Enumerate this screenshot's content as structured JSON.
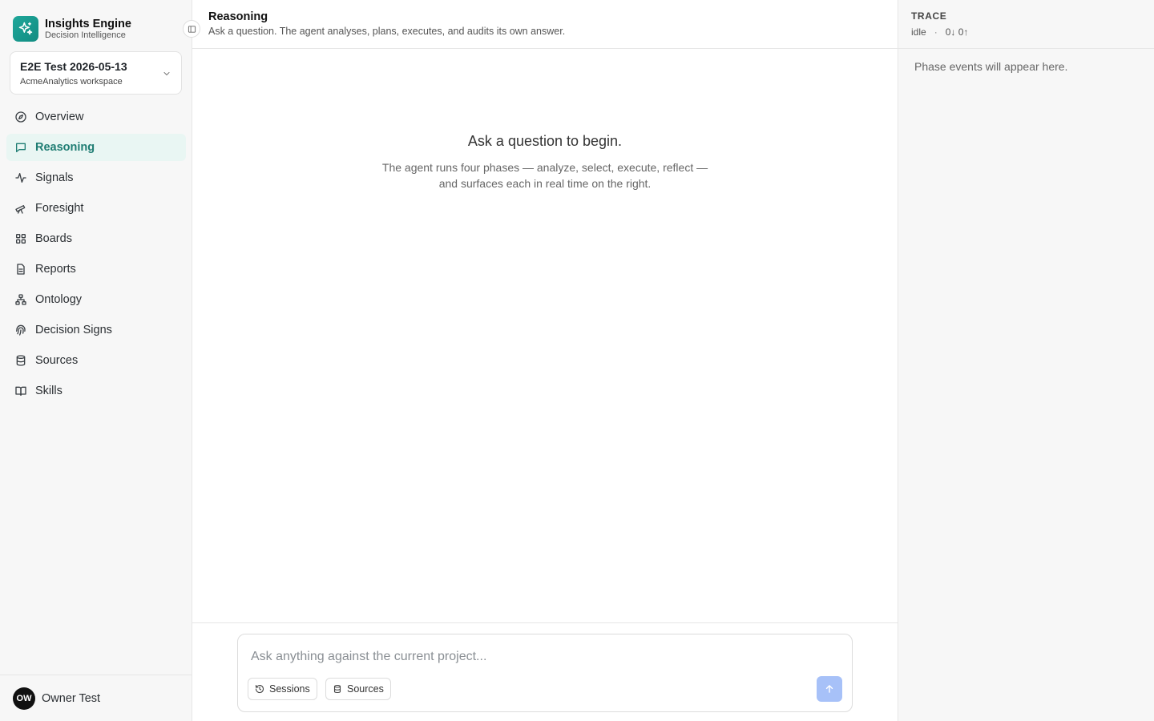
{
  "brand": {
    "name": "Insights Engine",
    "subtitle": "Decision Intelligence",
    "logo_icon": "sparkle-icon",
    "accent": "#1a9e92"
  },
  "workspace": {
    "name": "E2E Test 2026-05-13",
    "subtitle": "AcmeAnalytics workspace"
  },
  "nav": {
    "items": [
      {
        "label": "Overview",
        "icon": "compass-icon",
        "active": false
      },
      {
        "label": "Reasoning",
        "icon": "message-icon",
        "active": true
      },
      {
        "label": "Signals",
        "icon": "activity-icon",
        "active": false
      },
      {
        "label": "Foresight",
        "icon": "telescope-icon",
        "active": false
      },
      {
        "label": "Boards",
        "icon": "grid-icon",
        "active": false
      },
      {
        "label": "Reports",
        "icon": "document-icon",
        "active": false
      },
      {
        "label": "Ontology",
        "icon": "network-icon",
        "active": false
      },
      {
        "label": "Decision Signs",
        "icon": "fingerprint-icon",
        "active": false
      },
      {
        "label": "Sources",
        "icon": "database-icon",
        "active": false
      },
      {
        "label": "Skills",
        "icon": "book-icon",
        "active": false
      }
    ]
  },
  "user": {
    "initials": "OW",
    "name": "Owner Test"
  },
  "header": {
    "title": "Reasoning",
    "subtitle": "Ask a question. The agent analyses, plans, executes, and audits its own answer."
  },
  "empty_state": {
    "title": "Ask a question to begin.",
    "line1": "The agent runs four phases — analyze, select, execute, reflect —",
    "line2": "and surfaces each in real time on the right."
  },
  "composer": {
    "placeholder": "Ask anything against the current project...",
    "sessions_label": "Sessions",
    "sources_label": "Sources"
  },
  "trace": {
    "title": "TRACE",
    "status": "idle",
    "separator": "·",
    "counts": "0↓ 0↑",
    "empty": "Phase events will appear here."
  }
}
